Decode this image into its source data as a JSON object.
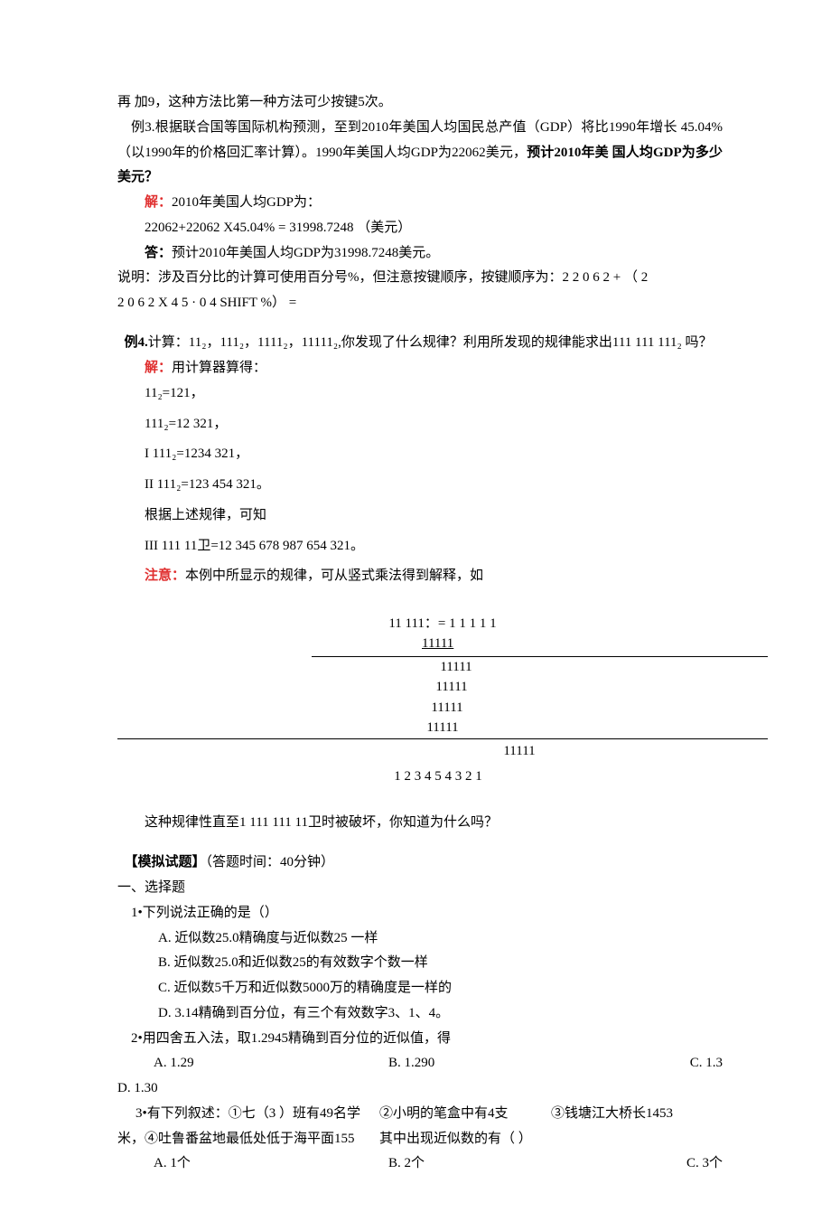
{
  "intro": {
    "line0": "再 加9，这种方法比第一种方法可少按键5次。",
    "line1_a": "例3.",
    "line1_b": "根据联合国等国际机构预测，至到2010年美国人均国民总产值（GDP）将比1990年增长 45.04% （以1990年的价格回汇率计算）。1990年美国人均GDP为22062美元，",
    "line1_c": "预计2010年美 国人均GDP为多少美元？",
    "solve_label": "解：",
    "solve_text": "2010年美国人均GDP为：",
    "calc_line": "22062+22062 X45.04% =  31998.7248 （美元）",
    "ans_label": "答：",
    "ans_text": "预计2010年美国人均GDP为31998.7248美元。",
    "note1": "说明：涉及百分比的计算可使用百分号%，但注意按键顺序，按键顺序为：2 2 0 6 2 + （ 2",
    "note2": " 2 0 6 2 X  4 5 ·  0 4 SHIFT %）     ="
  },
  "ex4": {
    "title_a": "例4.",
    "title_b": "计算：11₂，111₂，1111₂，11111₂,你发现了什么规律？利用所发现的规律能求出111 111 111₂ 吗？",
    "solve_label": "解：",
    "solve_text": "用计算器算得：",
    "r1": "11₂=121，",
    "r2": "111₂=12 321，",
    "r3": "I    111₂=1234 321，",
    "r4": "II    111₂=123 454 321。",
    "rule": "根据上述规律，可知",
    "r5": "III    111 11卫=12 345 678 987 654 321。",
    "caution_label": "注意：",
    "caution_text": "本例中所显示的规律，可从竖式乘法得到解释，如"
  },
  "mult": {
    "top1": "11 111：= 1 1 1 1 1",
    "top2": "11111",
    "m1": "11111",
    "m2": "11111",
    "m3": "11111",
    "m4": "11111",
    "m5": "11111",
    "result": "1 2 3 4 5 4 3 2 1",
    "tail": "这种规律性直至1 111 111 11卫时被破坏，你知道为什么吗？"
  },
  "exam": {
    "heading": "【模拟试题】",
    "time": "（答题时间：40分钟）",
    "sec1": "一、选择题",
    "q1": {
      "stem": "1•下列说法正确的是（）",
      "a": "A.  近似数25.0精确度与近似数25 一样",
      "b": "B.  近似数25.0和近似数25的有效数字个数一样",
      "c": "C.  近似数5千万和近似数5000万的精确度是一样的",
      "d": "D.  3.14精确到百分位，有三个有效数字3、1、4。"
    },
    "q2": {
      "stem": "2•用四舍五入法，取1.2945精确到百分位的近似值，得",
      "a": "A. 1.29",
      "b": "B. 1.290",
      "c": "C. 1.3",
      "d": "D. 1.30"
    },
    "q3": {
      "l1a": "3•有下列叙述：①七（3 ）班有49名学",
      "l1b": "②小明的笔盒中有4支",
      "l1c": "③钱塘江大桥长1453",
      "l2a": "米，④吐鲁番盆地最低处低于海平面155",
      "l2b": "其中出现近似数的有（     ）",
      "a": "A. 1个",
      "b": "B. 2个",
      "c": "C. 3个"
    }
  }
}
